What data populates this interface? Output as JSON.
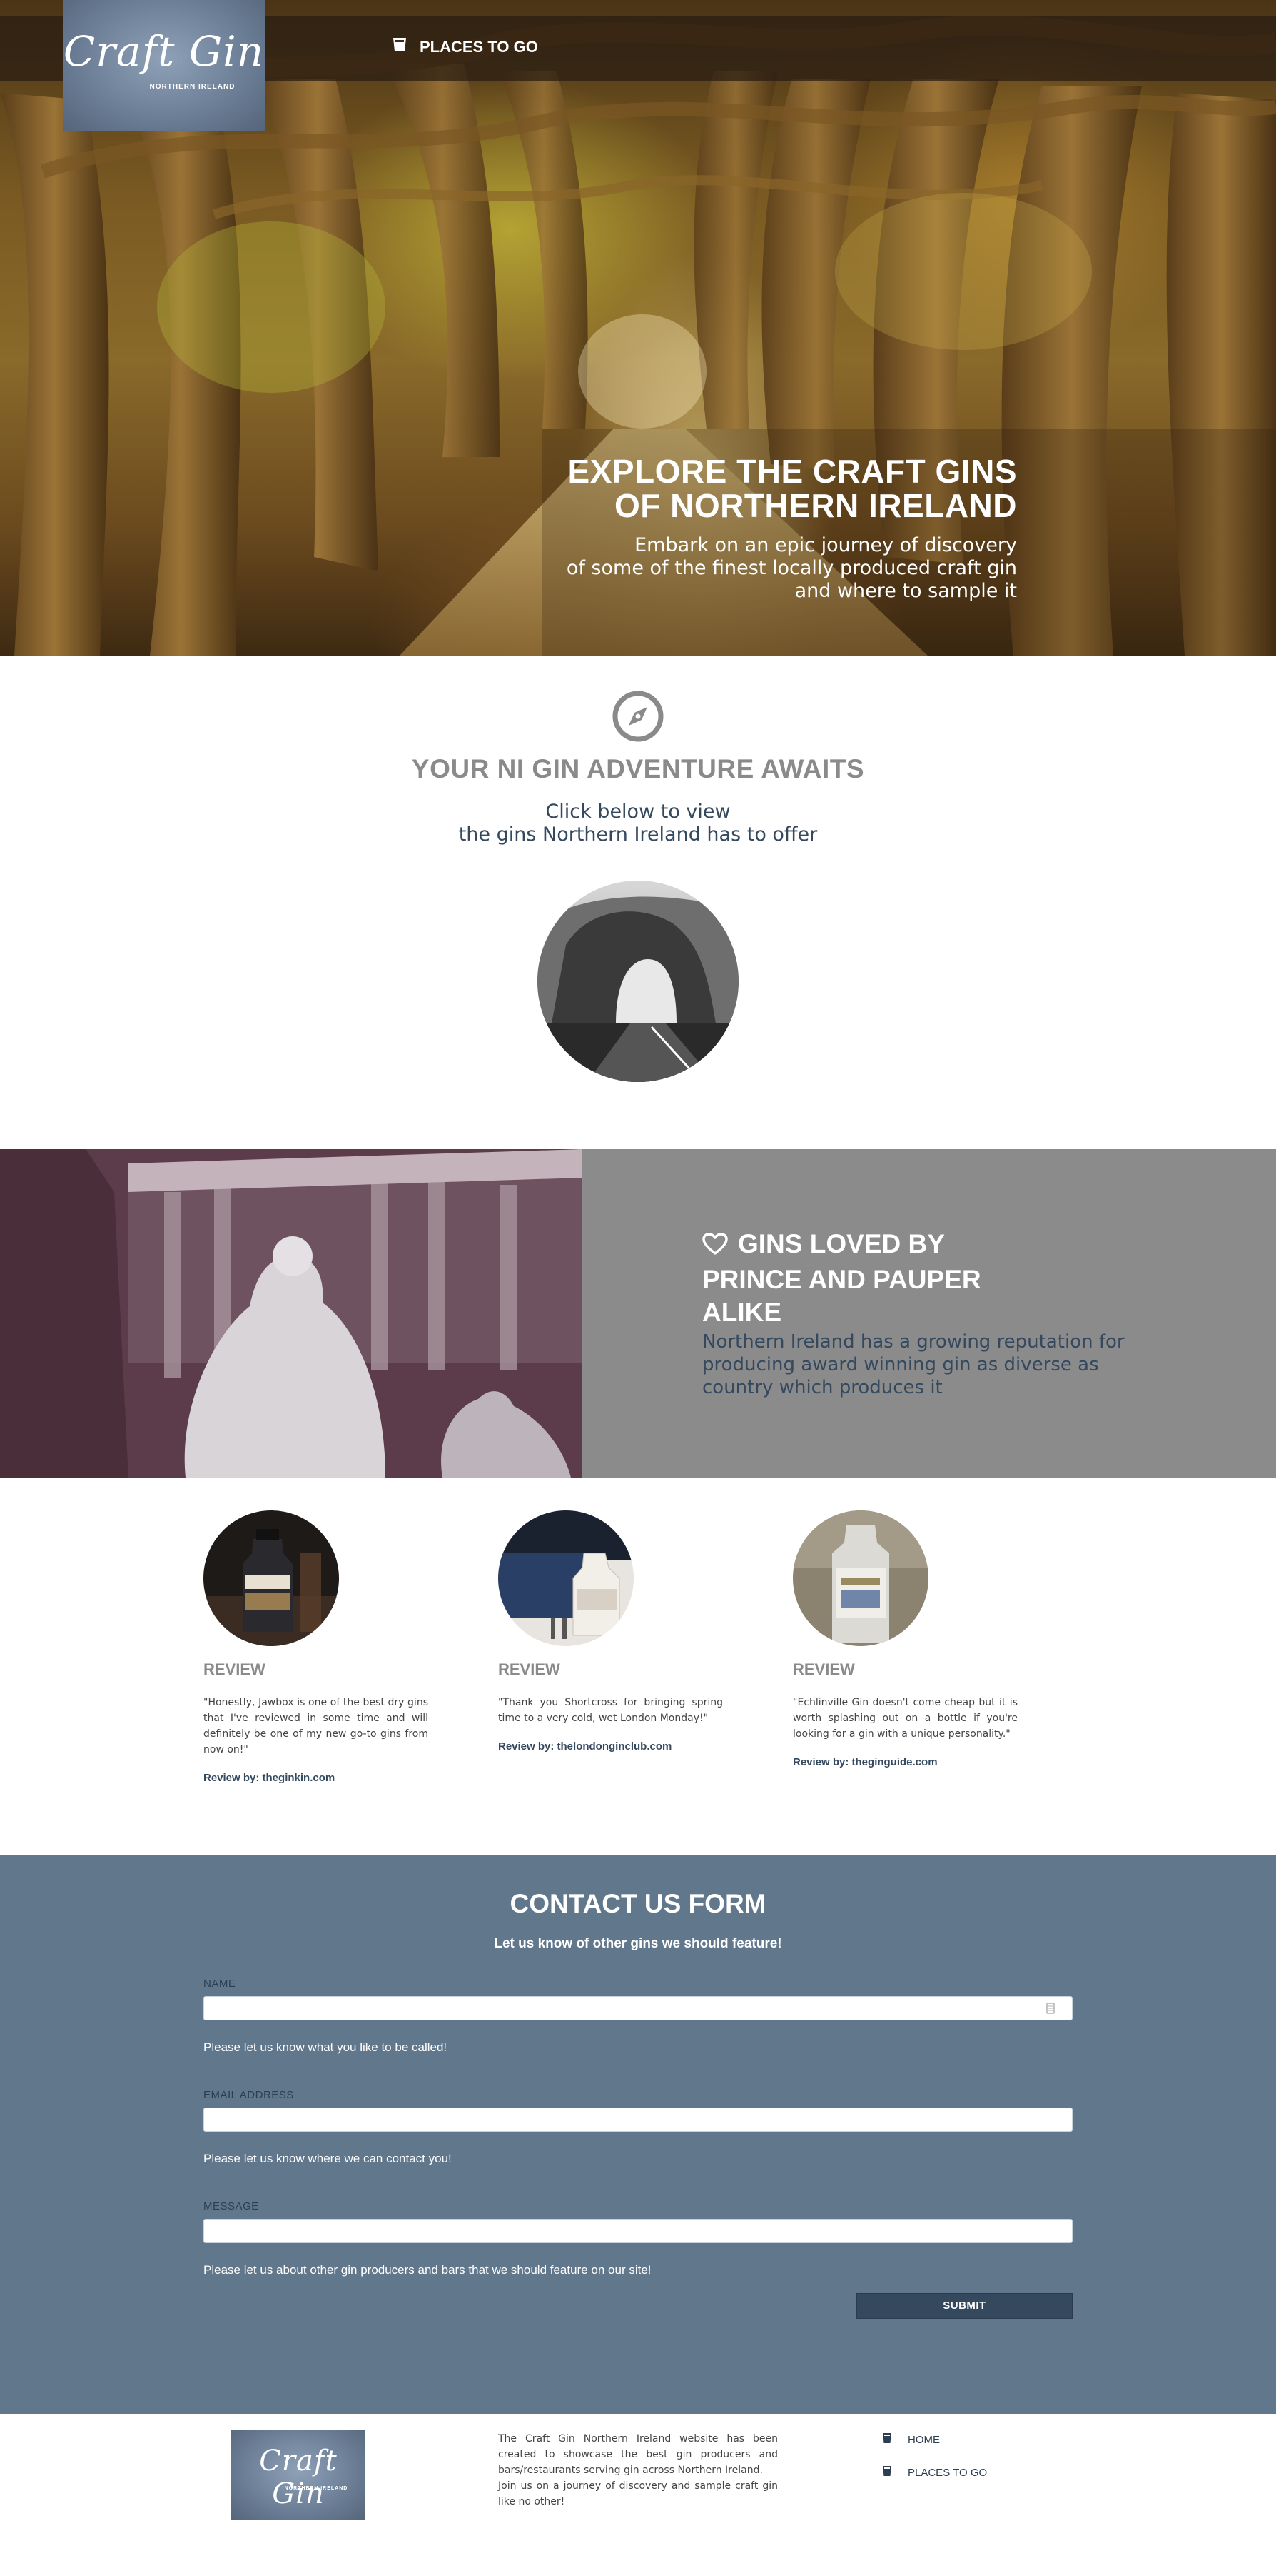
{
  "brand": {
    "logo_script": "Craft Gin",
    "logo_sub": "NORTHERN IRELAND"
  },
  "nav": {
    "places_label": "PLACES TO GO",
    "icon": "gin-glass-icon"
  },
  "hero": {
    "title_line1": "EXPLORE THE CRAFT GINS",
    "title_line2": "OF NORTHERN IRELAND",
    "sub_line1": "Embark on an epic journey of discovery",
    "sub_line2": "of some of the finest locally produced craft gin",
    "sub_line3": "and where to sample it"
  },
  "adventure": {
    "icon": "compass-icon",
    "title": "YOUR NI GIN ADVENTURE AWAITS",
    "sub_line1": "Click below to view",
    "sub_line2": "the gins Northern Ireland has to offer"
  },
  "loved": {
    "icon": "heart-icon",
    "title_line1": "GINS LOVED BY",
    "title_line2": "PRINCE AND PAUPER",
    "title_line3": "ALIKE",
    "sub": "Northern Ireland has a growing reputation for producing award winning gin as diverse as country which produces it"
  },
  "reviews": [
    {
      "heading": "REVIEW",
      "text": "\"Honestly, Jawbox is one of the best dry gins that I've reviewed in some time and will definitely be one of my new go-to gins from now on!\"",
      "by": "Review by: theginkin.com"
    },
    {
      "heading": "REVIEW",
      "text": "\"Thank you Shortcross for bringing spring time to a very cold, wet London Monday!\"",
      "by": "Review by: thelondonginclub.com"
    },
    {
      "heading": "REVIEW",
      "text": "\"Echlinville Gin doesn't come cheap but it is worth splashing out on a bottle if you're looking for a gin with a unique personality.\"",
      "by": "Review by: theginguide.com"
    }
  ],
  "contact": {
    "title": "CONTACT US FORM",
    "sub": "Let us know of other gins we should feature!",
    "name_label": "NAME",
    "name_value": "",
    "name_help": "Please let us know what you like to be called!",
    "email_label": "EMAIL ADDRESS",
    "email_value": "",
    "email_help": "Please let us know where we can contact you!",
    "message_label": "MESSAGE",
    "message_value": "",
    "message_help": "Please let us about other gin producers and bars that we should feature on our site!",
    "submit_label": "SUBMIT"
  },
  "footer": {
    "about_line1": "The Craft Gin Northern Ireland website has been created to showcase the best gin producers and bars/restaurants serving gin across Northern Ireland.",
    "about_line2": "Join us on a journey of discovery and sample craft gin like no other!",
    "nav_home": "HOME",
    "nav_places": "PLACES TO GO"
  },
  "colors": {
    "hero_overlay": "#281c12",
    "logo_bg": "#6d8098",
    "heading_grey": "#8a8a8a",
    "text_dark": "#34495e",
    "loved_bg": "#8b8b8b",
    "contact_bg": "#61778c",
    "submit_bg": "#34495e"
  }
}
